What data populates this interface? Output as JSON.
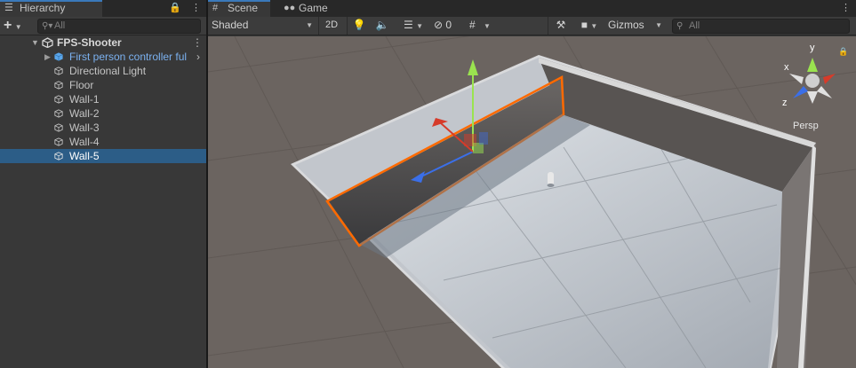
{
  "hierarchy": {
    "tab_label": "Hierarchy",
    "search_placeholder": "All",
    "add_label": "+",
    "scene_name": "FPS-Shooter",
    "items": [
      {
        "label": "First person controller ful",
        "prefab": true
      },
      {
        "label": "Directional Light",
        "prefab": false
      },
      {
        "label": "Floor",
        "prefab": false
      },
      {
        "label": "Wall-1",
        "prefab": false
      },
      {
        "label": "Wall-2",
        "prefab": false
      },
      {
        "label": "Wall-3",
        "prefab": false
      },
      {
        "label": "Wall-4",
        "prefab": false
      },
      {
        "label": "Wall-5",
        "prefab": false,
        "selected": true
      }
    ]
  },
  "scene_view": {
    "tabs": [
      {
        "label": "Scene",
        "active": true,
        "icon": "grid-icon"
      },
      {
        "label": "Game",
        "active": false,
        "icon": "gamepad-icon"
      }
    ],
    "draw_mode": "Shaded",
    "toggle_2d": "2D",
    "hidden_count": "0",
    "gizmos_label": "Gizmos",
    "search_placeholder": "All",
    "projection_label": "Persp",
    "axis_labels": {
      "x": "x",
      "y": "y",
      "z": "z"
    }
  },
  "colors": {
    "selection": "#2c5d87",
    "accent_tab": "#3a79bb",
    "prefab_text": "#7bb1f0",
    "outline": "#ff6a00"
  }
}
